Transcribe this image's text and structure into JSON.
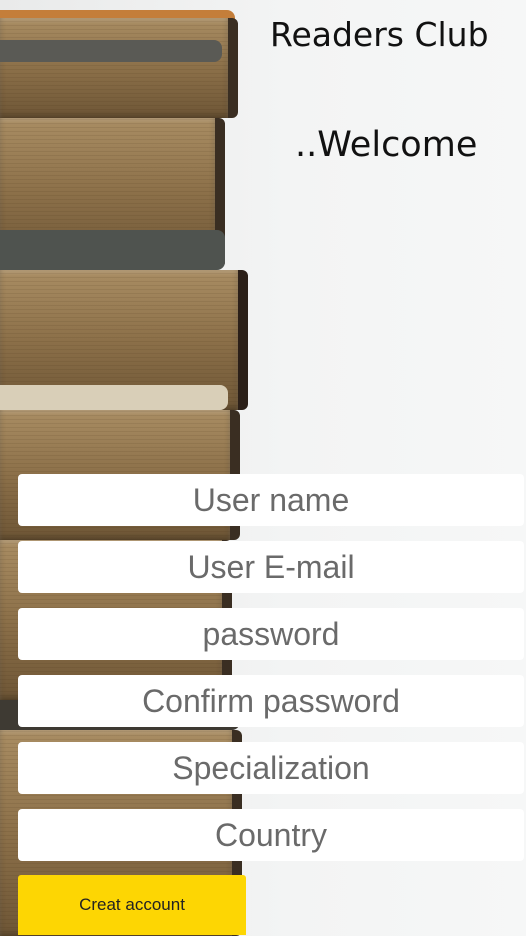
{
  "header": {
    "app_title": "Readers Club",
    "welcome": "..Welcome"
  },
  "form": {
    "username_placeholder": "User name",
    "email_placeholder": "User E-mail",
    "password_placeholder": "password",
    "confirm_password_placeholder": "Confirm password",
    "specialization_placeholder": "Specialization",
    "country_placeholder": "Country",
    "submit_label": "Creat account"
  },
  "colors": {
    "accent": "#fdd603",
    "field_background": "#ffffff",
    "placeholder_text": "#6a6a6a"
  },
  "background": {
    "image_subject": "stack-of-old-books"
  }
}
